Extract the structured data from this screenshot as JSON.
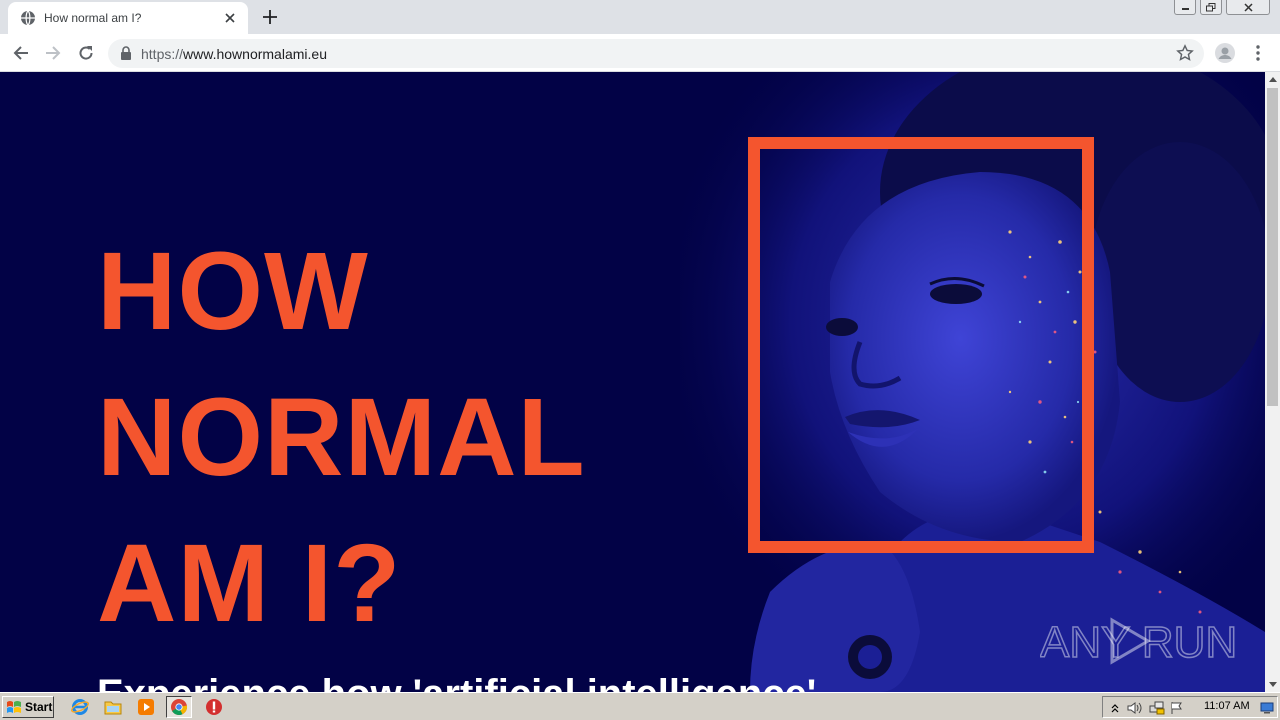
{
  "browser": {
    "tab": {
      "title": "How normal am I?",
      "favicon": "globe-icon",
      "close_icon": "close-icon"
    },
    "new_tab_icon": "plus-icon",
    "window_controls": [
      "minimize-icon",
      "restore-icon",
      "close-icon"
    ],
    "nav": {
      "back_icon": "arrow-left-icon",
      "forward_icon": "arrow-right-icon",
      "reload_icon": "reload-icon"
    },
    "address_bar": {
      "scheme": "https://",
      "host": "www.hownormalami.eu",
      "lock_icon": "lock-icon",
      "bookmark_icon": "star-icon"
    },
    "profile_icon": "avatar-icon",
    "menu_icon": "kebab-menu-icon"
  },
  "page": {
    "heading_lines": [
      "HOW",
      "NORMAL",
      "AM I?"
    ],
    "subtitle": "Experience how 'artificial intelligence' ...",
    "watermark": "ANY RUN",
    "colors": {
      "background": "#020246",
      "accent": "#f4552e",
      "subtitle": "#ffffff"
    }
  },
  "taskbar": {
    "start_label": "Start",
    "pinned": [
      "internet-explorer-icon",
      "folder-icon",
      "media-player-icon",
      "chrome-icon",
      "stop-icon"
    ],
    "active": "chrome-icon",
    "tray_icons": [
      "chevron-up-icon",
      "speaker-icon",
      "network-icon",
      "flag-icon"
    ],
    "clock": "11:07 AM",
    "show_desktop_icon": "desktop-icon"
  }
}
